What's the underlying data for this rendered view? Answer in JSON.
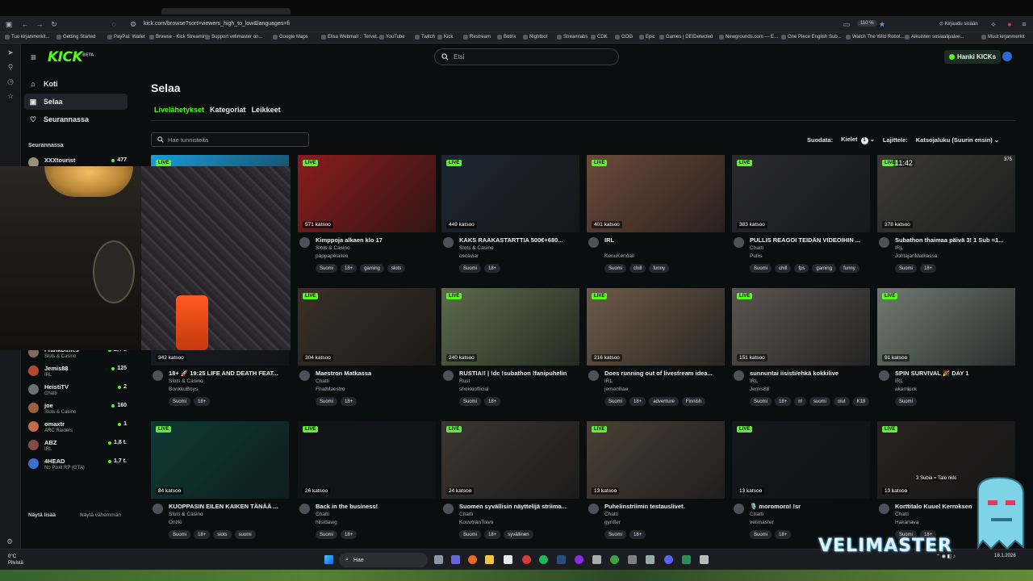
{
  "browser": {
    "url": "kick.com/browse?sort=viewers_high_to_low&languages=fi",
    "zoom": "110 %",
    "signin": "Kirjaudu sisään",
    "bookmarks": [
      "Tuo kirjanmerkit...",
      "Getting Started",
      "PayPal: Wallet",
      "Browse - Kick Streaming",
      "Support velimaster on...",
      "Google Maps",
      "Elisa Webmail :: Tervet...",
      "YouTube",
      "Twitch",
      "Kick",
      "Restream",
      "Botrix",
      "Nightbot",
      "Streamlabs",
      "CDK",
      "GOG",
      "Epic",
      "Games | DEIDetected",
      "Newgrounds.com — E...",
      "One Piece English Sub...",
      "Watch The Wild Robot...",
      "Aikuisten sosiaalipalve...",
      "Muut kirjanmerkit"
    ]
  },
  "header": {
    "logo": "KICK",
    "logo_badge": "BETA",
    "search_placeholder": "Etsi",
    "get_kicks": "Hanki KICKs"
  },
  "sidebar": {
    "nav": [
      {
        "label": "Koti",
        "icon": "home-icon"
      },
      {
        "label": "Selaa",
        "icon": "browse-icon"
      },
      {
        "label": "Seurannassa",
        "icon": "heart-icon"
      }
    ],
    "following_title": "Seurannassa",
    "following": [
      {
        "name": "XXXtourist",
        "category": "",
        "viewers": "477"
      },
      {
        "name": "FrankDimes",
        "category": "Slots & Casino",
        "viewers": "2,4 t."
      },
      {
        "name": "Jemis88",
        "category": "IRL",
        "viewers": "125"
      },
      {
        "name": "HeistiTV",
        "category": "Chatti",
        "viewers": "2"
      },
      {
        "name": "joe",
        "category": "Slots & Casino",
        "viewers": "160"
      },
      {
        "name": "omaxtr",
        "category": "ARC Raiders",
        "viewers": "1"
      },
      {
        "name": "ABZ",
        "category": "IRL",
        "viewers": "1,8 t."
      },
      {
        "name": "4HEAD",
        "category": "No Pixel RP (GTA)",
        "viewers": "1,7 t."
      }
    ],
    "show_more": "Näytä lisää",
    "show_less": "Näytä vähemmän"
  },
  "main": {
    "title": "Selaa",
    "tabs": [
      "Livelähetykset",
      "Kategoriat",
      "Leikkeet"
    ],
    "tag_search_placeholder": "Hae tunnisteita",
    "filter_label": "Suodata:",
    "languages_label": "Kielet",
    "languages_count": "1",
    "sort_label": "Lajittele:",
    "sort_value": "Katsojaluku (Suurin ensin)"
  },
  "live_label": "LIVE",
  "streams": [
    {
      "title": "",
      "category": "",
      "user": "",
      "viewers": "",
      "tags": [],
      "color": "#1a9bd8"
    },
    {
      "title": "Kimppoja alkaen klo 17",
      "category": "Slots & Casino",
      "user": "pappapelailee",
      "viewers": "571 katsoo",
      "tags": [
        "Suomi",
        "18+",
        "gaming",
        "slots"
      ],
      "color": "#8a1c1c"
    },
    {
      "title": "KAKS RAAKASTARTTIA 500€+680...",
      "category": "Slots & Casino",
      "user": "oscaviar",
      "viewers": "449 katsoo",
      "tags": [
        "Suomi",
        "18+"
      ],
      "color": "#1d2630"
    },
    {
      "title": "IRL",
      "category": "",
      "user": "KenuKendall",
      "viewers": "401 katsoo",
      "tags": [
        "Suomi",
        "chill",
        "funny"
      ],
      "color": "#6b4a3a"
    },
    {
      "title": "PULLIS REAGOI TEIDÄN VIDEOIHIN ...",
      "category": "Chatti",
      "user": "Pullis",
      "viewers": "383 katsoo",
      "tags": [
        "Suomi",
        "chill",
        "fps",
        "gaming",
        "funny"
      ],
      "color": "#2a2a2e"
    },
    {
      "title": "Subathon thaimaa päivä 3! 1 Sub =1...",
      "category": "IRL",
      "user": "JohtajanMatkassa",
      "viewers": "378 katsoo",
      "tags": [
        "Suomi",
        "18+"
      ],
      "color": "#3b3a36",
      "overlay": "11:42",
      "badge": "375"
    },
    {
      "title": "18+ 🚀 19:25 LIFE AND DEATH FEAT...",
      "category": "Slots & Casino",
      "user": "BonkkuBoys",
      "viewers": "342 katsoo",
      "tags": [
        "Suomi",
        "18+"
      ],
      "color": "#1a1d24"
    },
    {
      "title": "Maestron Matkassa",
      "category": "Chatti",
      "user": "FhatMaestro",
      "viewers": "304 katsoo",
      "tags": [
        "Suomi",
        "18+"
      ],
      "color": "#3a3027"
    },
    {
      "title": "RUSTIA!! | !dc !subathon !fanipuhelin",
      "category": "Rust",
      "user": "shokkioflicial",
      "viewers": "240 katsoo",
      "tags": [
        "Suomi",
        "18+"
      ],
      "color": "#5c6a4a"
    },
    {
      "title": "Does running out of livestream idea...",
      "category": "IRL",
      "user": "jemeniliae",
      "viewers": "216 katsoo",
      "tags": [
        "Suomi",
        "18+",
        "adventure",
        "Finnish"
      ],
      "color": "#6d5a48"
    },
    {
      "title": "sunnuntai iisisti/ehkä kokkilive",
      "category": "IRL",
      "user": "Jemis88",
      "viewers": "151 katsoo",
      "tags": [
        "Suomi",
        "18+",
        "irl",
        "suomi",
        "olut",
        "K18"
      ],
      "color": "#5a5550"
    },
    {
      "title": "SPIN SURVIVAL 🎉 DAY 1",
      "category": "IRL",
      "user": "akamkick",
      "viewers": "91 katsoo",
      "tags": [
        "Suomi"
      ],
      "color": "#6f7a70"
    },
    {
      "title": "KUOPPASIN EILEN KAIKEN TÄNÄÄ ...",
      "category": "Slots & Casino",
      "user": "Onzki",
      "viewers": "84 katsoo",
      "tags": [
        "Suomi",
        "18+",
        "slots",
        "suomi"
      ],
      "color": "#0e3a33"
    },
    {
      "title": "Back in the business!",
      "category": "Chatti",
      "user": "hilsidawg",
      "viewers": "26 katsoo",
      "tags": [
        "Suomi",
        "18+"
      ],
      "color": "#121318"
    },
    {
      "title": "Suomen syvällisin näyttelijä striima...",
      "category": "Chatti",
      "user": "KouvolanToivo",
      "viewers": "24 katsoo",
      "tags": [
        "Suomi",
        "18+",
        "syvällinen"
      ],
      "color": "#3b3631"
    },
    {
      "title": "Puhelinstriimin testauslivet.",
      "category": "Chatti",
      "user": "gyntter",
      "viewers": "13 katsoo",
      "tags": [
        "Suomi",
        "18+"
      ],
      "color": "#4a3f35"
    },
    {
      "title": "🎙️ moromoro! !sr",
      "category": "Chatti",
      "user": "velimaster",
      "viewers": "13 katsoo",
      "tags": [
        "Suomi",
        "18+"
      ],
      "color": "#15181c"
    },
    {
      "title": "Korttitalo Kuuel Kerroksen",
      "category": "Chatti",
      "user": "Hakanava",
      "viewers": "13 katsoo",
      "tags": [
        "Suomi",
        "18+"
      ],
      "color": "#26221f",
      "overlay": "3 Subia = Talo rikki"
    }
  ],
  "taskbar": {
    "weather_temp": "0°C",
    "weather_desc": "Pilvistä",
    "search": "Hae",
    "date": "18.1.2026"
  },
  "overlay_brand": "VELIMASTER",
  "colors": {
    "accent": "#53fc18",
    "background": "#0b0e0f"
  }
}
